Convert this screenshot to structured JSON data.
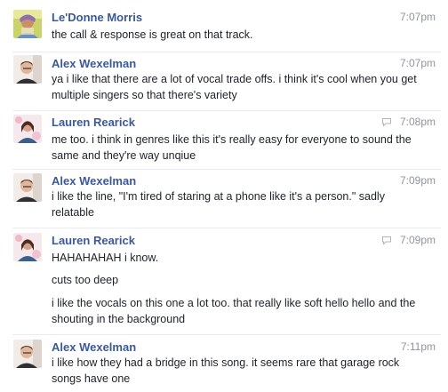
{
  "messages": [
    {
      "sender": "Le'Donne Morris",
      "time": "7:07pm",
      "avatar": "ledonne-avatar",
      "read_icon": false,
      "lines": [
        "the call & response is great on that track."
      ]
    },
    {
      "sender": "Alex Wexelman",
      "time": "7:07pm",
      "avatar": "alex-avatar",
      "read_icon": false,
      "lines": [
        "ya i like that there are a lot of vocal trade offs. i think it's cool when you get multiple singers so that there's variety"
      ]
    },
    {
      "sender": "Lauren Rearick",
      "time": "7:08pm",
      "avatar": "lauren-avatar",
      "read_icon": true,
      "lines": [
        "me too. i think in genres like this it's really easy for everyone to sound the same and they're way unqiue"
      ]
    },
    {
      "sender": "Alex Wexelman",
      "time": "7:09pm",
      "avatar": "alex-avatar",
      "read_icon": false,
      "lines": [
        "i like the line, \"I'm tired of staring at a phone like it's a person.\" sadly relatable"
      ]
    },
    {
      "sender": "Lauren Rearick",
      "time": "7:09pm",
      "avatar": "lauren-avatar",
      "read_icon": true,
      "lines": [
        "HAHAHAHAH i know.",
        "cuts too deep",
        "i like the vocals on this one a lot too. that really like soft hello hello and the shouting in the background"
      ]
    },
    {
      "sender": "Alex Wexelman",
      "time": "7:11pm",
      "avatar": "alex-avatar",
      "read_icon": false,
      "lines": [
        "i like how they had a bridge in this song. it seems rare that garage rock songs have one"
      ]
    }
  ],
  "colors": {
    "sender_link": "#3b5998",
    "timestamp": "#90949c",
    "body_text": "#1d2129",
    "divider": "#e9ebee"
  }
}
